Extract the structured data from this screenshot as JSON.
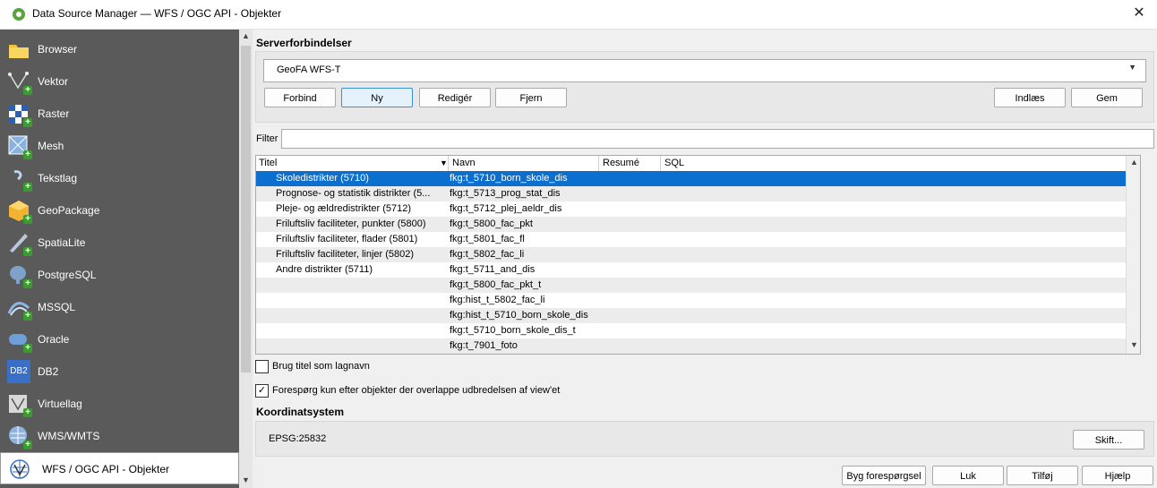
{
  "window": {
    "title": "Data Source Manager — WFS / OGC API - Objekter",
    "close_glyph": "✕"
  },
  "sidebar": {
    "items": [
      {
        "label": "Browser",
        "icon": "folder-icon"
      },
      {
        "label": "Vektor",
        "icon": "vector-icon"
      },
      {
        "label": "Raster",
        "icon": "raster-icon"
      },
      {
        "label": "Mesh",
        "icon": "mesh-icon"
      },
      {
        "label": "Tekstlag",
        "icon": "text-layer-icon"
      },
      {
        "label": "GeoPackage",
        "icon": "geopackage-icon"
      },
      {
        "label": "SpatiaLite",
        "icon": "spatialite-icon"
      },
      {
        "label": "PostgreSQL",
        "icon": "postgresql-icon"
      },
      {
        "label": "MSSQL",
        "icon": "mssql-icon"
      },
      {
        "label": "Oracle",
        "icon": "oracle-icon"
      },
      {
        "label": "DB2",
        "icon": "db2-icon"
      },
      {
        "label": "Virtuellag",
        "icon": "virtual-layer-icon"
      },
      {
        "label": "WMS/WMTS",
        "icon": "wms-icon"
      },
      {
        "label": "WFS / OGC API - Objekter",
        "icon": "wfs-icon"
      }
    ],
    "active_index": 13,
    "db2_text": "DB2"
  },
  "server": {
    "section_title": "Serverforbindelser",
    "connection": "GeoFA WFS-T",
    "buttons": {
      "connect": "Forbind",
      "new": "Ny",
      "edit": "Redigér",
      "remove": "Fjern",
      "load": "Indlæs",
      "save": "Gem"
    }
  },
  "filter": {
    "label": "Filter",
    "value": ""
  },
  "table": {
    "columns": [
      "Titel",
      "Navn",
      "Resumé",
      "SQL"
    ],
    "rows": [
      {
        "title": "Skoledistrikter (5710)",
        "name": "fkg:t_5710_born_skole_dis"
      },
      {
        "title": "Prognose- og statistik distrikter (5...",
        "name": "fkg:t_5713_prog_stat_dis"
      },
      {
        "title": "Pleje- og ældredistrikter (5712)",
        "name": "fkg:t_5712_plej_aeldr_dis"
      },
      {
        "title": "Friluftsliv faciliteter, punkter (5800)",
        "name": "fkg:t_5800_fac_pkt"
      },
      {
        "title": "Friluftsliv faciliteter, flader (5801)",
        "name": "fkg:t_5801_fac_fl"
      },
      {
        "title": "Friluftsliv faciliteter,  linjer (5802)",
        "name": "fkg:t_5802_fac_li"
      },
      {
        "title": "Andre distrikter (5711)",
        "name": "fkg:t_5711_and_dis"
      },
      {
        "title": "",
        "name": "fkg:t_5800_fac_pkt_t"
      },
      {
        "title": "",
        "name": "fkg:hist_t_5802_fac_li"
      },
      {
        "title": "",
        "name": "fkg:hist_t_5710_born_skole_dis"
      },
      {
        "title": "",
        "name": "fkg:t_5710_born_skole_dis_t"
      },
      {
        "title": "",
        "name": "fkg:t_7901_foto"
      }
    ],
    "selected_index": 0
  },
  "options": {
    "use_title": {
      "label": "Brug titel som lagnavn",
      "checked": false
    },
    "only_extent": {
      "label": "Forespørg kun efter objekter der overlappe udbredelsen af view'et",
      "checked": true,
      "check_glyph": "✓"
    }
  },
  "crs": {
    "section_title": "Koordinatsystem",
    "value": "EPSG:25832",
    "change_button": "Skift..."
  },
  "footer": {
    "build_query": "Byg forespørgsel",
    "close": "Luk",
    "add": "Tilføj",
    "help": "Hjælp"
  },
  "colors": {
    "sidebar_bg": "#5a5a5a",
    "selection": "#0b6fcf",
    "qgis_green": "#58a33b"
  }
}
